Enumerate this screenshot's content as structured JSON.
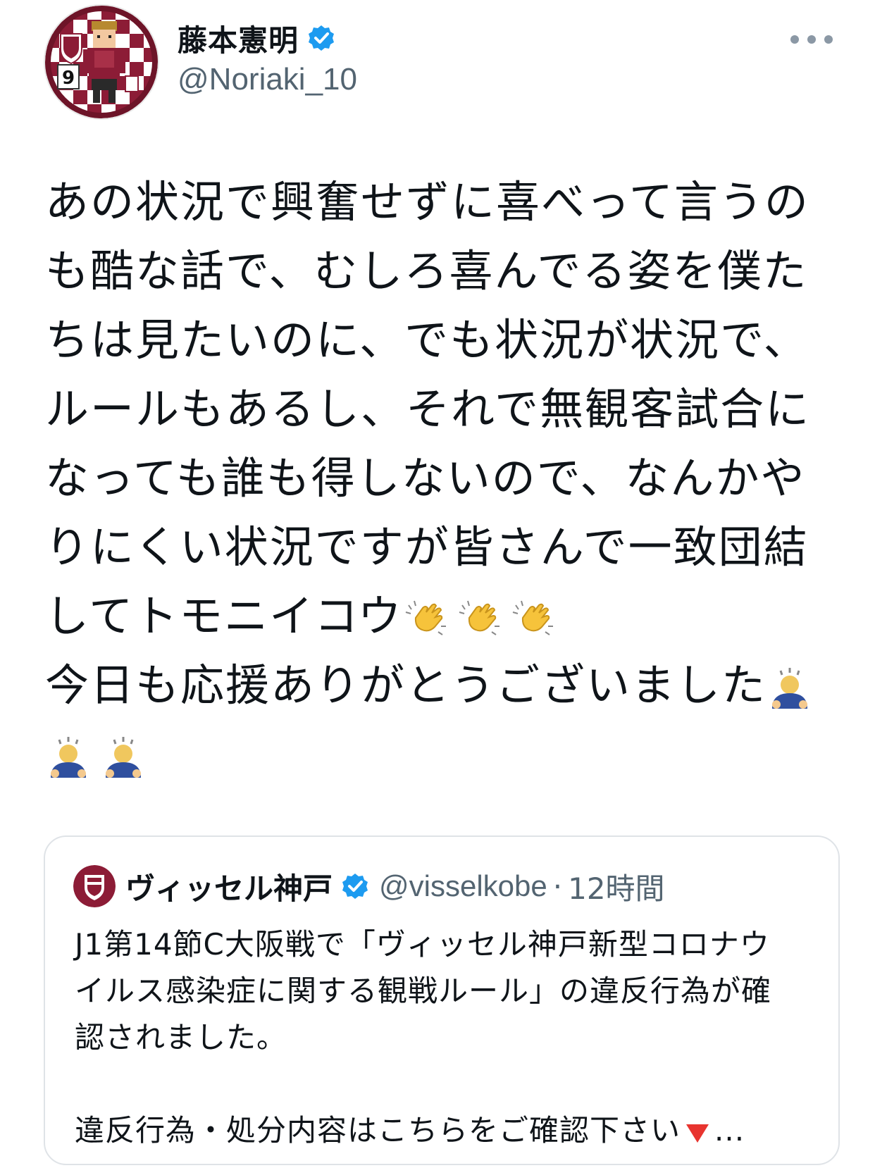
{
  "author": {
    "display_name": "藤本憲明",
    "handle": "@Noriaki_10",
    "avatar_number": "9"
  },
  "tweet": {
    "lines": [
      "あの状況で興奮せずに喜べって言うの",
      "も酷な話で、むしろ喜んでる姿を僕た",
      "ちは見たいのに、でも状況が状況で、",
      "ルールもあるし、それで無観客試合に",
      "なっても誰も得しないので、なんかや",
      "りにくい状況ですが皆さんで一致団結",
      "してトモニイコウ",
      "今日も応援ありがとうございました"
    ]
  },
  "quote": {
    "display_name": "ヴィッセル神戸",
    "handle": "@visselkobe",
    "separator": "·",
    "time": "12時間",
    "lines": [
      "J1第14節C大阪戦で「ヴィッセル神戸新型コロナウ",
      "イルス感染症に関する観戦ルール」の違反行為が確",
      "認されました。",
      "",
      "違反行為・処分内容はこちらをご確認下さい"
    ],
    "ellipsis": "..."
  },
  "colors": {
    "verified_blue": "#1d9bf0",
    "vissel_crimson": "#8c1c36",
    "secondary_text": "#536471",
    "card_border": "#dfe3e7"
  }
}
